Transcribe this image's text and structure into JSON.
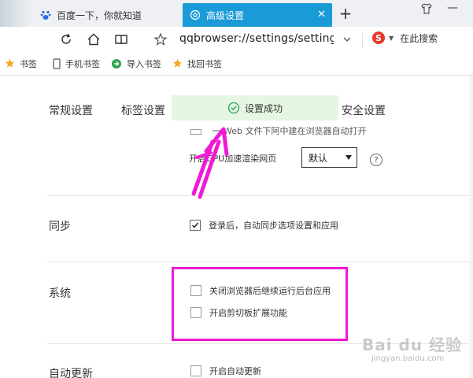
{
  "tabs": [
    {
      "label": "百度一下，你就知道",
      "active": false
    },
    {
      "label": "高级设置",
      "active": true
    }
  ],
  "toolbar": {
    "url": "qqbrowser://settings/setting",
    "search_label": "在此搜索"
  },
  "bookmarks": [
    {
      "label": "书签",
      "icon": "star-icon"
    },
    {
      "label": "手机书签",
      "icon": "phone-icon"
    },
    {
      "label": "导入书签",
      "icon": "import-icon"
    },
    {
      "label": "找回书签",
      "icon": "star-icon"
    }
  ],
  "settings_nav": {
    "general": "常规设置",
    "tabs": "标签设置",
    "security": "安全设置"
  },
  "toast": {
    "message": "设置成功"
  },
  "partial_row": "一 Web 文件下阿中建在浏览器自动打开",
  "gpu": {
    "label": "开启GPU加速渲染网页",
    "select_value": "默认"
  },
  "sections": {
    "sync": {
      "title": "同步",
      "option": "登录后，自动同步选项设置和应用",
      "checked": true
    },
    "system": {
      "title": "系统",
      "options": [
        {
          "label": "关闭浏览器后继续运行后台应用",
          "checked": false
        },
        {
          "label": "开启剪切板扩展功能",
          "checked": false
        }
      ]
    },
    "update": {
      "title": "自动更新",
      "option": "开启自动更新",
      "checked": false
    }
  },
  "watermark": {
    "brand": "Bai du 经验",
    "url": "jingyan.baidu.com"
  },
  "colors": {
    "active_tab": "#1a9bd7",
    "toast_bg": "#e6f6e2",
    "success_green": "#2ea44f",
    "annotation_magenta": "#f01ad5"
  }
}
